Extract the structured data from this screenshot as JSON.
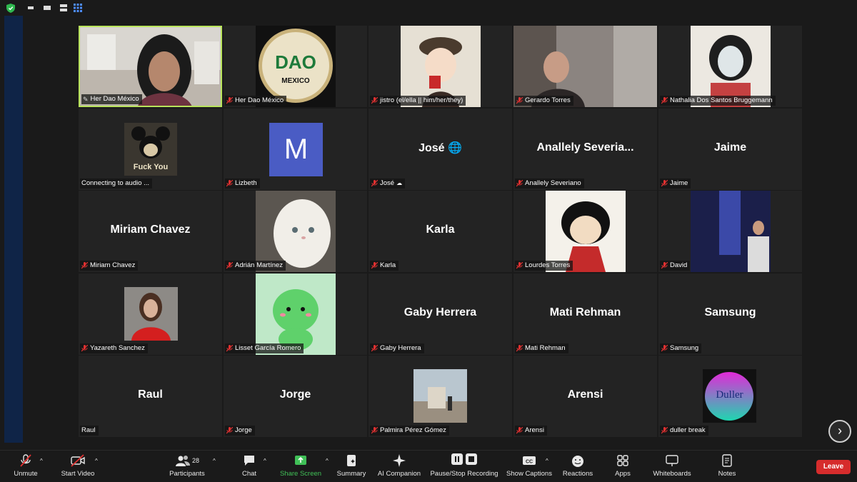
{
  "participants": [
    {
      "name": "Her Dao México",
      "label": "Her Dao México",
      "video": "photo",
      "pinned": true,
      "active": true
    },
    {
      "name": "Her Dao México",
      "label": "Her Dao México",
      "video": "logo"
    },
    {
      "name": "jistro",
      "label": "jistro (el/ella || him/her/they)",
      "video": "anime"
    },
    {
      "name": "Gerardo Torres",
      "label": "Gerardo Torres",
      "video": "photo"
    },
    {
      "name": "Nathalia Dos Santos Bruggemann",
      "label": "Nathalia Dos Santos Bruggemann",
      "video": "illustration"
    },
    {
      "name": "Connecting to audio",
      "label": "Connecting to audio ...",
      "video": "mickey",
      "picture_text": "Fuck You"
    },
    {
      "name": "Lizbeth",
      "label": "Lizbeth",
      "video": "initial",
      "initial": "M"
    },
    {
      "name": "José 🌐",
      "label": "José",
      "video": "name"
    },
    {
      "name": "Anallely  Severia...",
      "label": "Anallely Severiano",
      "video": "name"
    },
    {
      "name": "Jaime",
      "label": "Jaime",
      "video": "name"
    },
    {
      "name": "Miriam Chavez",
      "label": "Miriam Chavez",
      "video": "name"
    },
    {
      "name": "Adrián Martínez",
      "label": "Adrián Martínez",
      "video": "cat"
    },
    {
      "name": "Karla",
      "label": "Karla",
      "video": "name"
    },
    {
      "name": "Lourdes Torres",
      "label": "Lourdes Torres",
      "video": "mafalda"
    },
    {
      "name": "David",
      "label": "David",
      "video": "summit"
    },
    {
      "name": "Yazareth Sanchez",
      "label": "Yazareth Sanchez",
      "video": "portrait"
    },
    {
      "name": "Lisset García Romero",
      "label": "Lisset García Romero",
      "video": "dino"
    },
    {
      "name": "Gaby Herrera",
      "label": "Gaby Herrera",
      "video": "name"
    },
    {
      "name": "Mati Rehman",
      "label": "Mati Rehman",
      "video": "name"
    },
    {
      "name": "Samsung",
      "label": "Samsung",
      "video": "name"
    },
    {
      "name": "Raul",
      "label": "Raul",
      "video": "name",
      "muted": false
    },
    {
      "name": "Jorge",
      "label": "Jorge",
      "video": "name"
    },
    {
      "name": "Palmira Pérez Gómez",
      "label": "Palmira Pérez Gómez",
      "video": "fountain"
    },
    {
      "name": "Arensi",
      "label": "Arensi",
      "video": "name"
    },
    {
      "name": "duller break",
      "label": "duller break",
      "video": "duller",
      "picture_text": "Duller"
    }
  ],
  "toolbar": {
    "unmute": "Unmute",
    "start_video": "Start Video",
    "participants": "Participants",
    "participants_count": "28",
    "chat": "Chat",
    "share_screen": "Share Screen",
    "summary": "Summary",
    "ai_companion": "AI Companion",
    "recording": "Pause/Stop Recording",
    "captions": "Show Captions",
    "reactions": "Reactions",
    "apps": "Apps",
    "whiteboards": "Whiteboards",
    "notes": "Notes",
    "leave": "Leave"
  },
  "colors": {
    "active_border": "#b8e35b",
    "leave": "#d62c2c",
    "share": "#40c057",
    "mute": "#e03131"
  }
}
